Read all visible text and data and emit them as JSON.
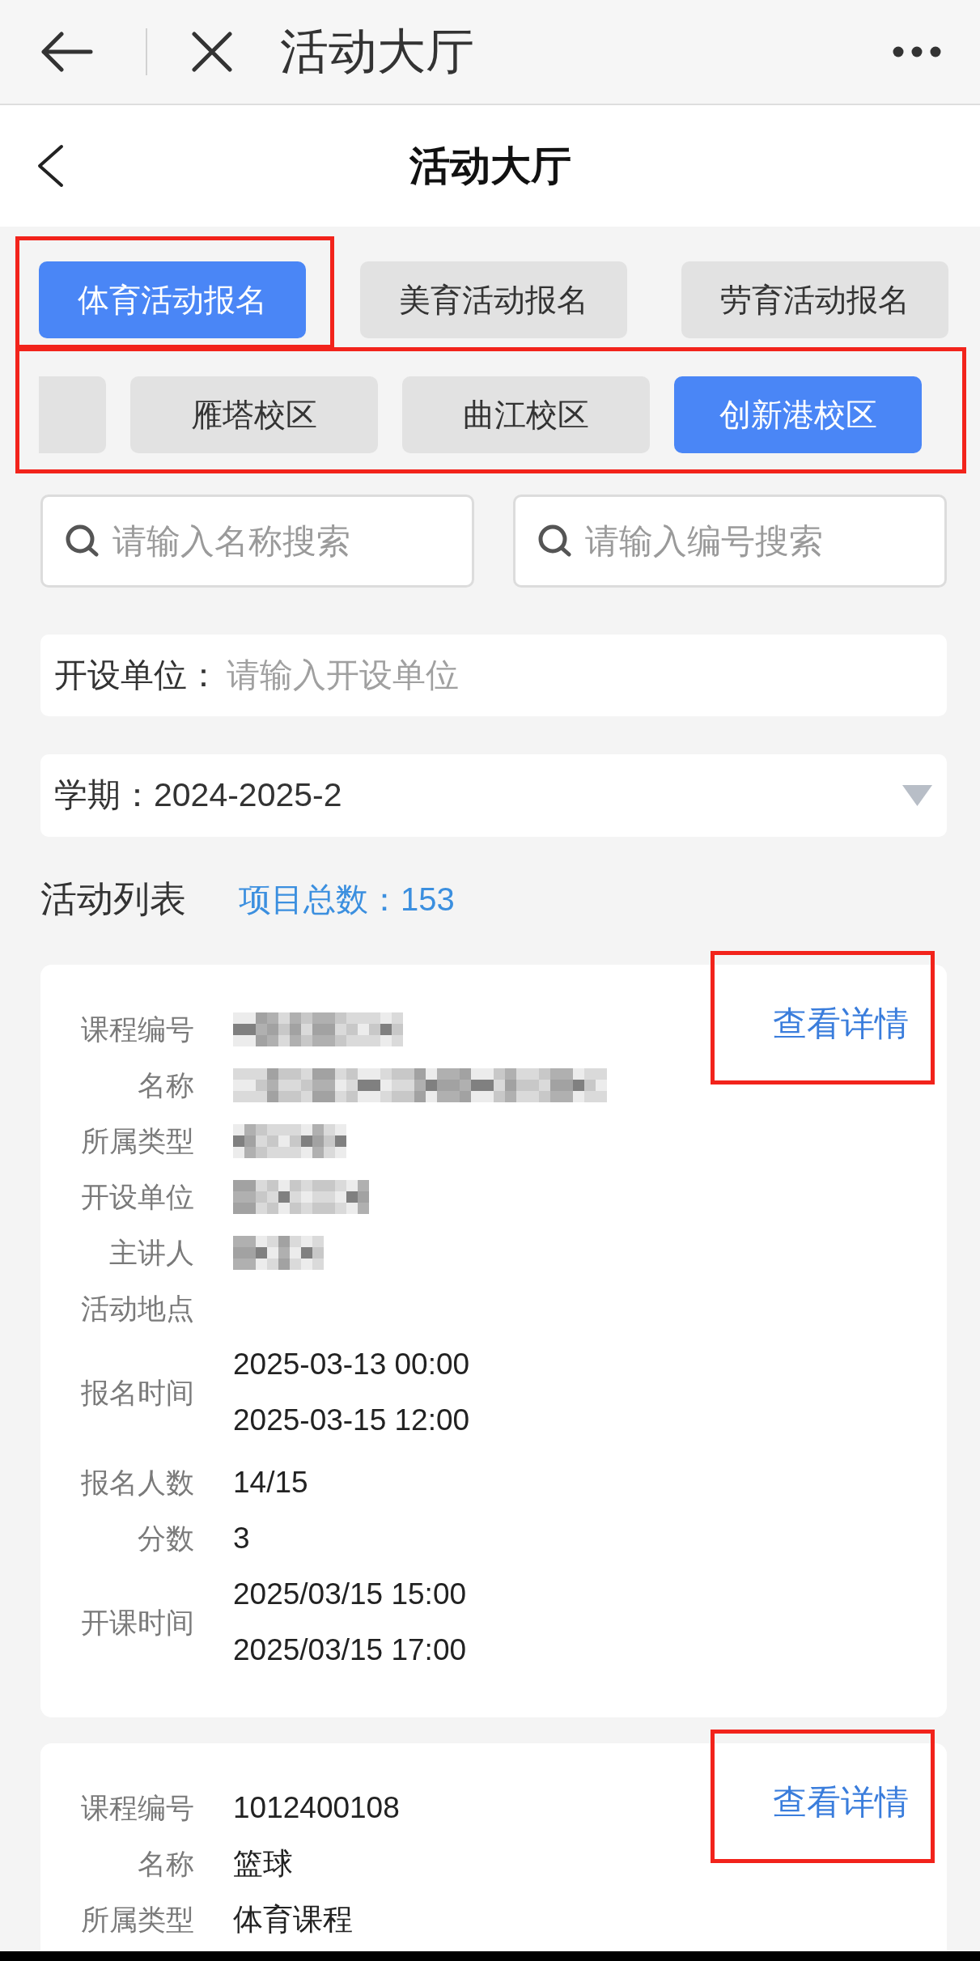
{
  "browser_bar": {
    "title": "活动大厅"
  },
  "header": {
    "title": "活动大厅"
  },
  "category_tabs": [
    {
      "label": "体育活动报名",
      "selected": true,
      "highlighted": true
    },
    {
      "label": "美育活动报名",
      "selected": false,
      "highlighted": false
    },
    {
      "label": "劳育活动报名",
      "selected": false,
      "highlighted": false
    }
  ],
  "campus_tabs": {
    "highlighted": true,
    "items": [
      {
        "selected": false
      },
      {
        "label": "雁塔校区",
        "selected": false
      },
      {
        "label": "曲江校区",
        "selected": false
      },
      {
        "label": "创新港校区",
        "selected": true
      }
    ]
  },
  "search_fields": [
    {
      "placeholder": "请输入名称搜索"
    },
    {
      "placeholder": "请输入编号搜索"
    }
  ],
  "unit_field": {
    "label": "开设单位：",
    "placeholder": "请输入开设单位"
  },
  "term_select": {
    "label": "学期：",
    "value": "2024-2025-2"
  },
  "activity_list": {
    "title": "活动列表",
    "total_label": "项目总数：",
    "total": "153"
  },
  "cards": [
    {
      "detail_link": "查看详情",
      "detail_highlighted": true,
      "fields": [
        {
          "label": "课程编号",
          "kind": "redacted"
        },
        {
          "label": "名称",
          "kind": "redacted"
        },
        {
          "label": "所属类型",
          "kind": "redacted"
        },
        {
          "label": "开设单位",
          "kind": "redacted"
        },
        {
          "label": "主讲人",
          "kind": "redacted"
        },
        {
          "label": "活动地点",
          "kind": "empty"
        },
        {
          "label": "报名时间",
          "kind": "lines",
          "values": [
            "2025-03-13 00:00",
            "2025-03-15 12:00"
          ]
        },
        {
          "label": "报名人数",
          "kind": "text",
          "value": "14/15"
        },
        {
          "label": "分数",
          "kind": "text",
          "value": "3"
        },
        {
          "label": "开课时间",
          "kind": "lines",
          "values": [
            "2025/03/15 15:00",
            "2025/03/15 17:00"
          ]
        }
      ]
    },
    {
      "detail_link": "查看详情",
      "detail_highlighted": true,
      "fields": [
        {
          "label": "课程编号",
          "kind": "text",
          "value": "1012400108"
        },
        {
          "label": "名称",
          "kind": "text",
          "value": "篮球"
        },
        {
          "label": "所属类型",
          "kind": "text",
          "value": "体育课程"
        }
      ]
    }
  ]
}
